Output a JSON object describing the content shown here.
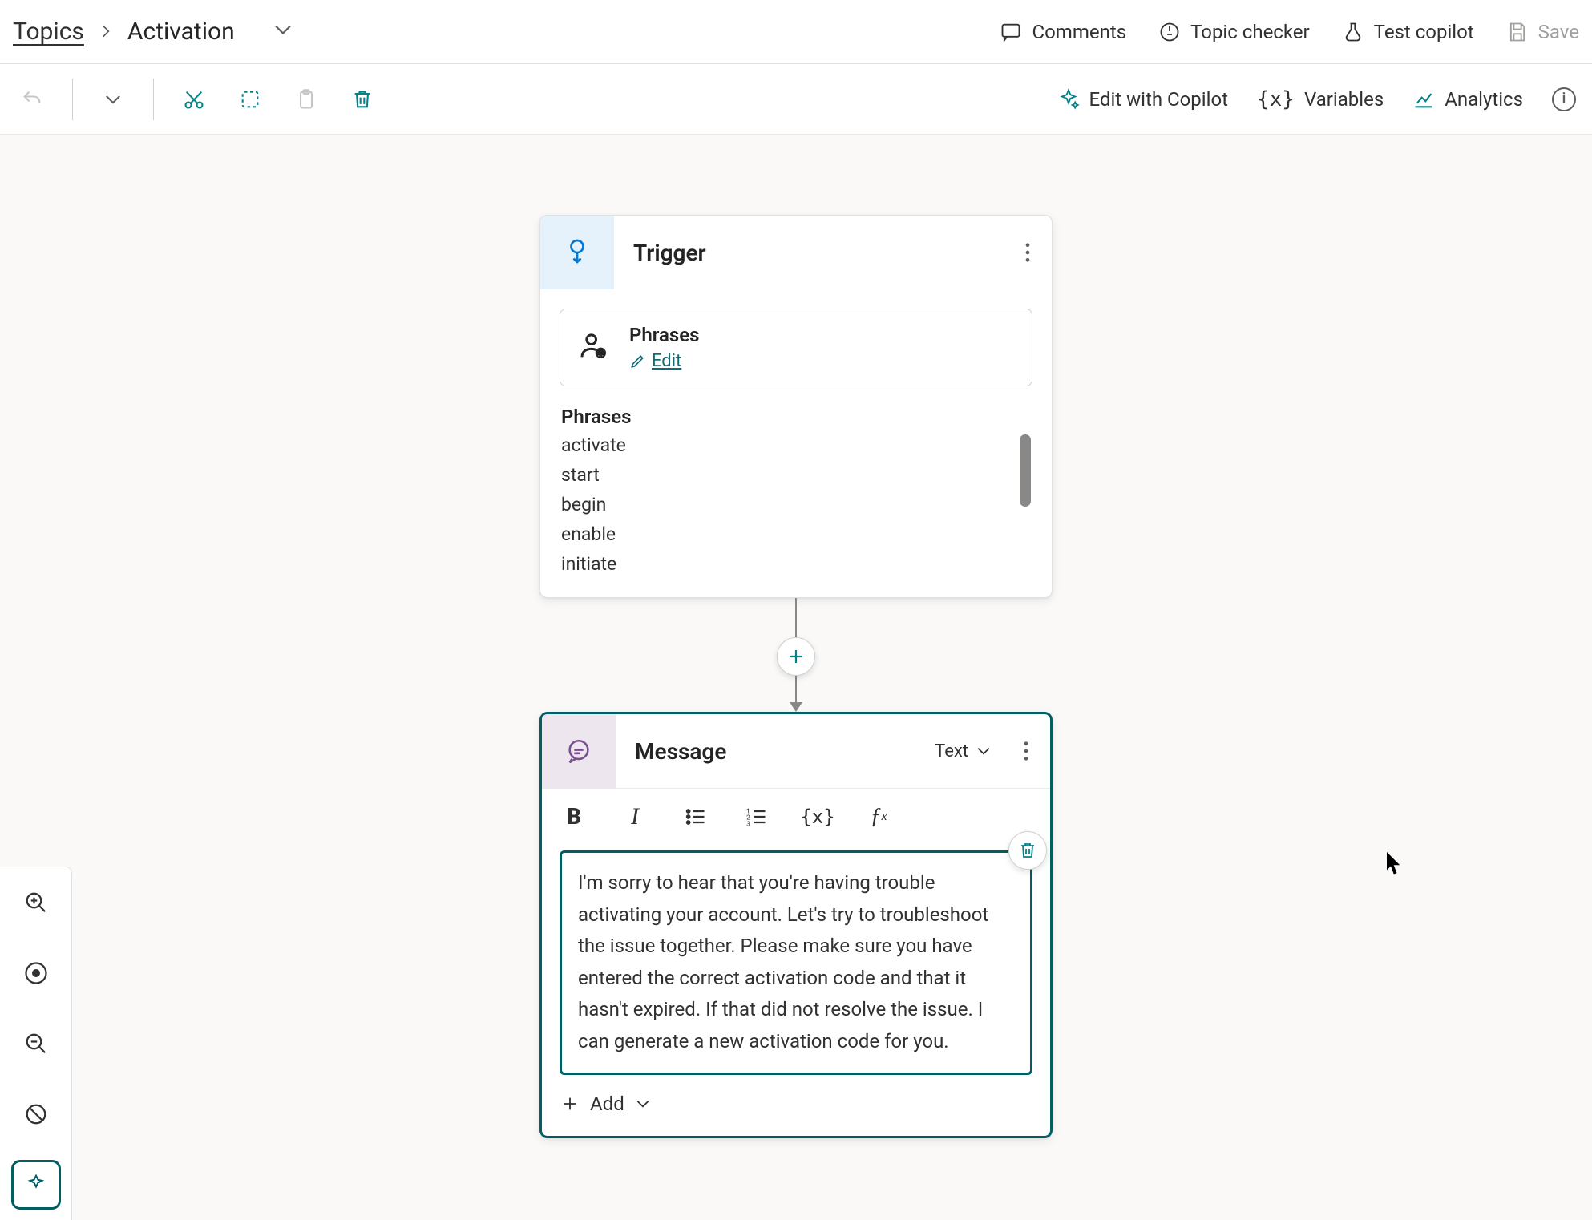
{
  "breadcrumb": {
    "root": "Topics",
    "current": "Activation"
  },
  "titleActions": {
    "comments": "Comments",
    "topic_checker": "Topic checker",
    "test_copilot": "Test copilot",
    "save": "Save"
  },
  "toolbar": {
    "edit_with_copilot": "Edit with Copilot",
    "variables": "Variables",
    "analytics": "Analytics"
  },
  "trigger": {
    "title": "Trigger",
    "phrases_card_title": "Phrases",
    "edit_label": "Edit",
    "phrases_header": "Phrases",
    "phrases": [
      "activate",
      "start",
      "begin",
      "enable",
      "initiate"
    ]
  },
  "message": {
    "title": "Message",
    "type_label": "Text",
    "body": "I'm sorry to hear that you're having trouble activating your account. Let's try to troubleshoot the issue together. Please make sure you have entered the correct activation code and that it hasn't expired. If that did not resolve the issue. I can generate a new activation code for you.",
    "add_label": "Add"
  }
}
